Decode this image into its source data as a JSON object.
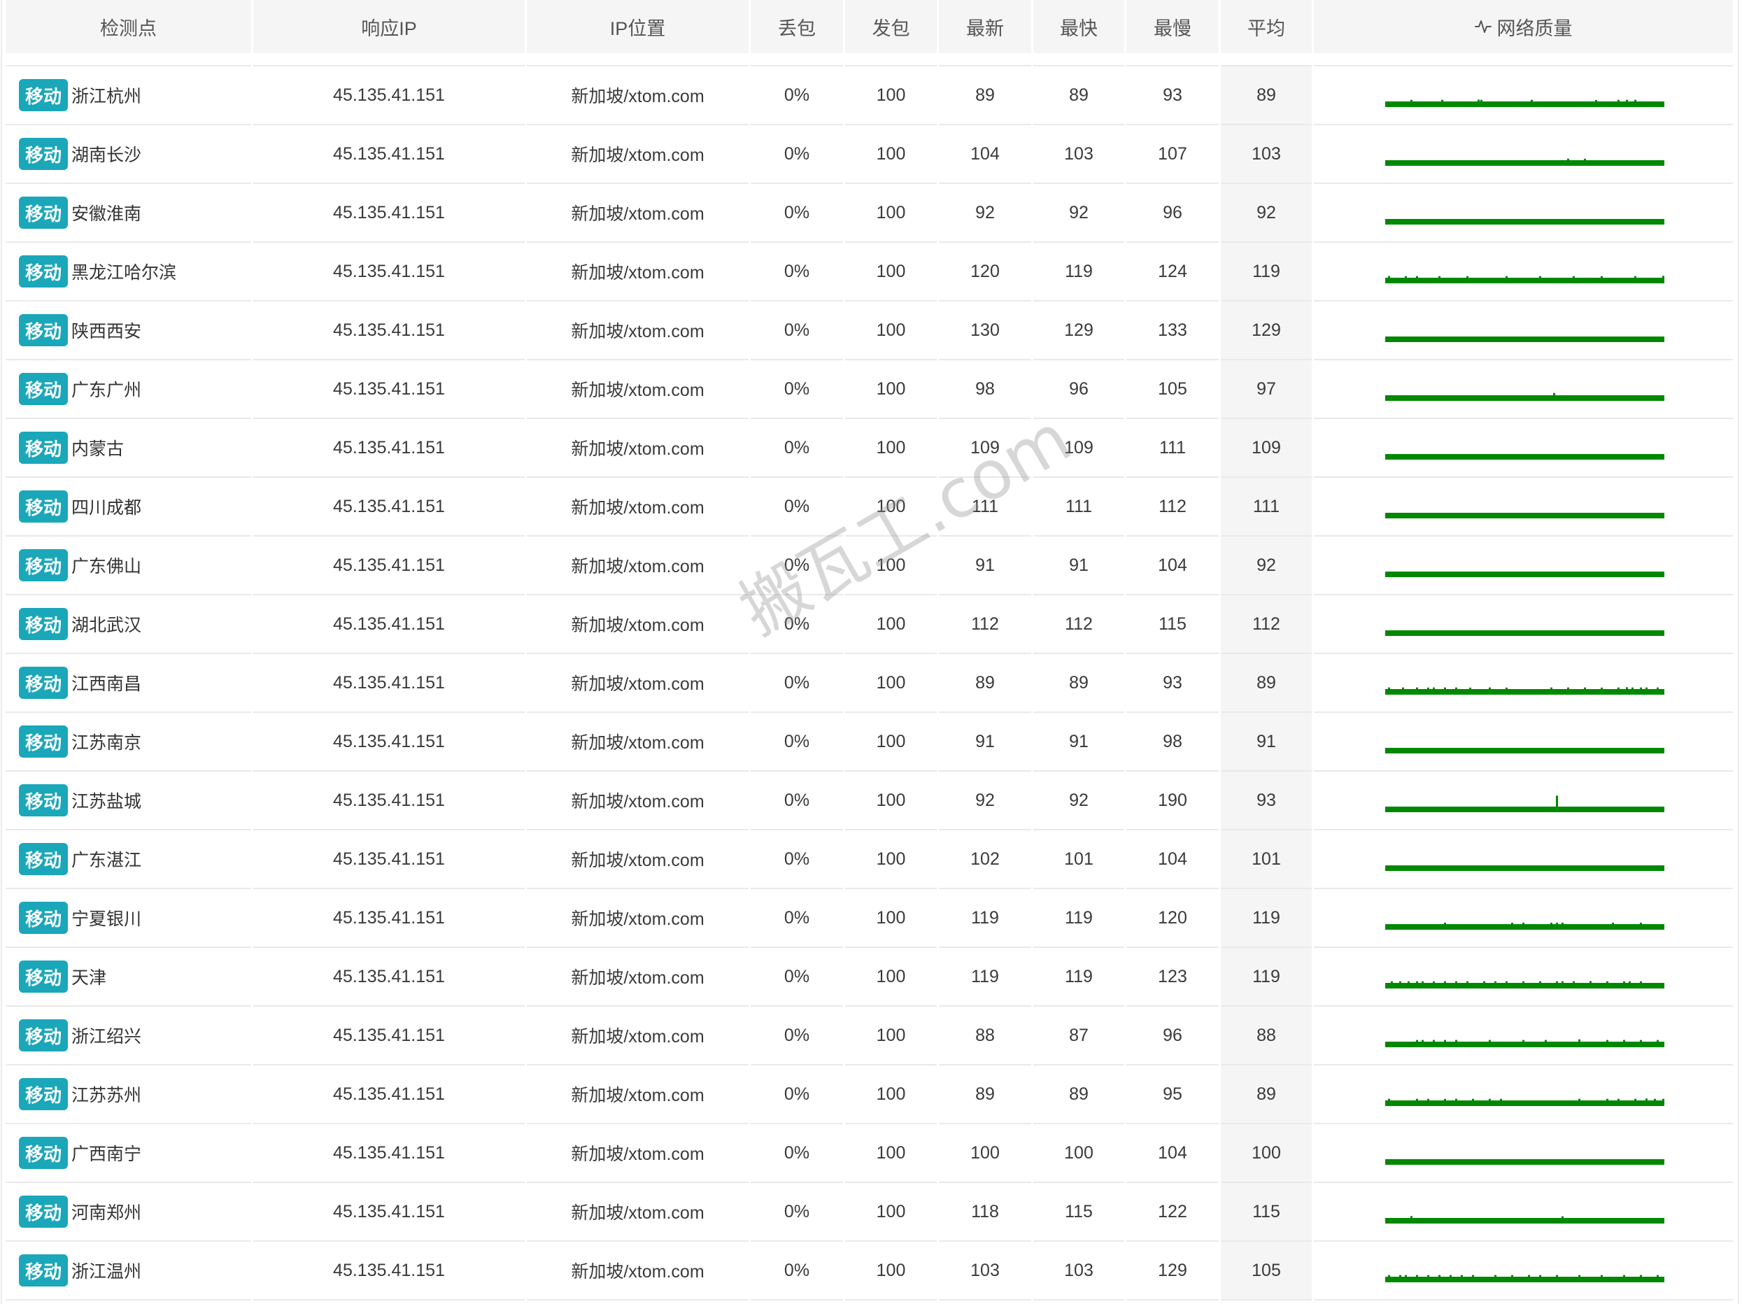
{
  "table": {
    "columns": [
      "检测点",
      "响应IP",
      "IP位置",
      "丢包",
      "发包",
      "最新",
      "最快",
      "最慢",
      "平均",
      "网络质量"
    ],
    "rows": [
      {
        "isp": "移动",
        "location": "浙江杭州",
        "ip": "45.135.41.151",
        "ip_location": "新加坡/xtom.com",
        "loss": "0%",
        "sent": "100",
        "latest": "89",
        "fastest": "89",
        "slowest": "93",
        "average": "89",
        "quality_spikes": [
          [
            9,
            91
          ],
          [
            20,
            91
          ],
          [
            33,
            93
          ],
          [
            34,
            92
          ],
          [
            52,
            91
          ],
          [
            75,
            90
          ],
          [
            83,
            91
          ],
          [
            86,
            91
          ],
          [
            89,
            92
          ]
        ]
      },
      {
        "isp": "移动",
        "location": "湖南长沙",
        "ip": "45.135.41.151",
        "ip_location": "新加坡/xtom.com",
        "loss": "0%",
        "sent": "100",
        "latest": "104",
        "fastest": "103",
        "slowest": "107",
        "average": "103",
        "quality_spikes": [
          [
            65,
            105
          ],
          [
            71,
            104
          ]
        ]
      },
      {
        "isp": "移动",
        "location": "安徽淮南",
        "ip": "45.135.41.151",
        "ip_location": "新加坡/xtom.com",
        "loss": "0%",
        "sent": "100",
        "latest": "92",
        "fastest": "92",
        "slowest": "96",
        "average": "92",
        "quality_spikes": []
      },
      {
        "isp": "移动",
        "location": "黑龙江哈尔滨",
        "ip": "45.135.41.151",
        "ip_location": "新加坡/xtom.com",
        "loss": "0%",
        "sent": "100",
        "latest": "120",
        "fastest": "119",
        "slowest": "124",
        "average": "119",
        "quality_spikes": [
          [
            1,
            122
          ],
          [
            7,
            121
          ],
          [
            11,
            121
          ],
          [
            19,
            121
          ],
          [
            29,
            121
          ],
          [
            43,
            121
          ],
          [
            55,
            121
          ],
          [
            67,
            121
          ],
          [
            77,
            121
          ],
          [
            89,
            121
          ],
          [
            99,
            124
          ]
        ]
      },
      {
        "isp": "移动",
        "location": "陕西西安",
        "ip": "45.135.41.151",
        "ip_location": "新加坡/xtom.com",
        "loss": "0%",
        "sent": "100",
        "latest": "130",
        "fastest": "129",
        "slowest": "133",
        "average": "129",
        "quality_spikes": []
      },
      {
        "isp": "移动",
        "location": "广东广州",
        "ip": "45.135.41.151",
        "ip_location": "新加坡/xtom.com",
        "loss": "0%",
        "sent": "100",
        "latest": "98",
        "fastest": "96",
        "slowest": "105",
        "average": "97",
        "quality_spikes": [
          [
            60,
            105
          ]
        ]
      },
      {
        "isp": "移动",
        "location": "内蒙古",
        "ip": "45.135.41.151",
        "ip_location": "新加坡/xtom.com",
        "loss": "0%",
        "sent": "100",
        "latest": "109",
        "fastest": "109",
        "slowest": "111",
        "average": "109",
        "quality_spikes": []
      },
      {
        "isp": "移动",
        "location": "四川成都",
        "ip": "45.135.41.151",
        "ip_location": "新加坡/xtom.com",
        "loss": "0%",
        "sent": "100",
        "latest": "111",
        "fastest": "111",
        "slowest": "112",
        "average": "111",
        "quality_spikes": []
      },
      {
        "isp": "移动",
        "location": "广东佛山",
        "ip": "45.135.41.151",
        "ip_location": "新加坡/xtom.com",
        "loss": "0%",
        "sent": "100",
        "latest": "91",
        "fastest": "91",
        "slowest": "104",
        "average": "92",
        "quality_spikes": []
      },
      {
        "isp": "移动",
        "location": "湖北武汉",
        "ip": "45.135.41.151",
        "ip_location": "新加坡/xtom.com",
        "loss": "0%",
        "sent": "100",
        "latest": "112",
        "fastest": "112",
        "slowest": "115",
        "average": "112",
        "quality_spikes": []
      },
      {
        "isp": "移动",
        "location": "江西南昌",
        "ip": "45.135.41.151",
        "ip_location": "新加坡/xtom.com",
        "loss": "0%",
        "sent": "100",
        "latest": "89",
        "fastest": "89",
        "slowest": "93",
        "average": "89",
        "quality_spikes": [
          [
            1,
            91
          ],
          [
            6,
            91
          ],
          [
            11,
            91
          ],
          [
            15,
            90
          ],
          [
            17,
            91
          ],
          [
            21,
            91
          ],
          [
            25,
            91
          ],
          [
            30,
            90
          ],
          [
            37,
            91
          ],
          [
            43,
            90
          ],
          [
            59,
            91
          ],
          [
            65,
            91
          ],
          [
            71,
            91
          ],
          [
            77,
            90
          ],
          [
            83,
            91
          ],
          [
            86,
            93
          ],
          [
            88,
            91
          ],
          [
            91,
            91
          ],
          [
            93,
            91
          ],
          [
            97,
            91
          ]
        ]
      },
      {
        "isp": "移动",
        "location": "江苏南京",
        "ip": "45.135.41.151",
        "ip_location": "新加坡/xtom.com",
        "loss": "0%",
        "sent": "100",
        "latest": "91",
        "fastest": "91",
        "slowest": "98",
        "average": "91",
        "quality_spikes": []
      },
      {
        "isp": "移动",
        "location": "江苏盐城",
        "ip": "45.135.41.151",
        "ip_location": "新加坡/xtom.com",
        "loss": "0%",
        "sent": "100",
        "latest": "92",
        "fastest": "92",
        "slowest": "190",
        "average": "93",
        "quality_spikes": [
          [
            61,
            190
          ]
        ]
      },
      {
        "isp": "移动",
        "location": "广东湛江",
        "ip": "45.135.41.151",
        "ip_location": "新加坡/xtom.com",
        "loss": "0%",
        "sent": "100",
        "latest": "102",
        "fastest": "101",
        "slowest": "104",
        "average": "101",
        "quality_spikes": []
      },
      {
        "isp": "移动",
        "location": "宁夏银川",
        "ip": "45.135.41.151",
        "ip_location": "新加坡/xtom.com",
        "loss": "0%",
        "sent": "100",
        "latest": "119",
        "fastest": "119",
        "slowest": "120",
        "average": "119",
        "quality_spikes": [
          [
            21,
            120
          ],
          [
            45,
            120
          ],
          [
            49,
            120
          ],
          [
            59,
            120
          ],
          [
            61,
            120
          ],
          [
            63,
            120
          ],
          [
            81,
            120
          ],
          [
            91,
            120
          ]
        ]
      },
      {
        "isp": "移动",
        "location": "天津",
        "ip": "45.135.41.151",
        "ip_location": "新加坡/xtom.com",
        "loss": "0%",
        "sent": "100",
        "latest": "119",
        "fastest": "119",
        "slowest": "123",
        "average": "119",
        "quality_spikes": [
          [
            2,
            121
          ],
          [
            5,
            121
          ],
          [
            8,
            121
          ],
          [
            11,
            121
          ],
          [
            13,
            121
          ],
          [
            17,
            121
          ],
          [
            21,
            121
          ],
          [
            25,
            121
          ],
          [
            29,
            121
          ],
          [
            35,
            121
          ],
          [
            39,
            121
          ],
          [
            43,
            121
          ],
          [
            49,
            121
          ],
          [
            55,
            121
          ],
          [
            61,
            121
          ],
          [
            63,
            121
          ],
          [
            67,
            121
          ],
          [
            73,
            123
          ],
          [
            79,
            121
          ],
          [
            85,
            121
          ],
          [
            87,
            121
          ],
          [
            91,
            121
          ]
        ]
      },
      {
        "isp": "移动",
        "location": "浙江绍兴",
        "ip": "45.135.41.151",
        "ip_location": "新加坡/xtom.com",
        "loss": "0%",
        "sent": "100",
        "latest": "88",
        "fastest": "87",
        "slowest": "96",
        "average": "88",
        "quality_spikes": [
          [
            11,
            90
          ],
          [
            13,
            90
          ],
          [
            17,
            90
          ],
          [
            21,
            90
          ],
          [
            25,
            90
          ],
          [
            37,
            90
          ],
          [
            49,
            90
          ],
          [
            57,
            90
          ],
          [
            69,
            96
          ],
          [
            79,
            90
          ],
          [
            85,
            90
          ],
          [
            91,
            90
          ],
          [
            97,
            90
          ]
        ]
      },
      {
        "isp": "移动",
        "location": "江苏苏州",
        "ip": "45.135.41.151",
        "ip_location": "新加坡/xtom.com",
        "loss": "0%",
        "sent": "100",
        "latest": "89",
        "fastest": "89",
        "slowest": "95",
        "average": "89",
        "quality_spikes": [
          [
            1,
            91
          ],
          [
            11,
            91
          ],
          [
            15,
            91
          ],
          [
            21,
            91
          ],
          [
            25,
            91
          ],
          [
            31,
            91
          ],
          [
            37,
            91
          ],
          [
            41,
            91
          ],
          [
            69,
            91
          ],
          [
            79,
            91
          ],
          [
            83,
            91
          ],
          [
            89,
            91
          ],
          [
            93,
            95
          ],
          [
            96,
            91
          ],
          [
            99,
            91
          ]
        ]
      },
      {
        "isp": "移动",
        "location": "广西南宁",
        "ip": "45.135.41.151",
        "ip_location": "新加坡/xtom.com",
        "loss": "0%",
        "sent": "100",
        "latest": "100",
        "fastest": "100",
        "slowest": "104",
        "average": "100",
        "quality_spikes": []
      },
      {
        "isp": "移动",
        "location": "河南郑州",
        "ip": "45.135.41.151",
        "ip_location": "新加坡/xtom.com",
        "loss": "0%",
        "sent": "100",
        "latest": "118",
        "fastest": "115",
        "slowest": "122",
        "average": "115",
        "quality_spikes": [
          [
            9,
            120
          ],
          [
            63,
            117
          ]
        ]
      },
      {
        "isp": "移动",
        "location": "浙江温州",
        "ip": "45.135.41.151",
        "ip_location": "新加坡/xtom.com",
        "loss": "0%",
        "sent": "100",
        "latest": "103",
        "fastest": "103",
        "slowest": "129",
        "average": "105",
        "quality_spikes": [
          [
            1,
            106
          ],
          [
            5,
            106
          ],
          [
            7,
            106
          ],
          [
            11,
            106
          ],
          [
            15,
            106
          ],
          [
            19,
            106
          ],
          [
            23,
            106
          ],
          [
            27,
            106
          ],
          [
            31,
            106
          ],
          [
            39,
            106
          ],
          [
            45,
            106
          ],
          [
            51,
            106
          ],
          [
            55,
            106
          ],
          [
            61,
            106
          ],
          [
            69,
            106
          ],
          [
            77,
            106
          ],
          [
            85,
            106
          ],
          [
            91,
            106
          ],
          [
            97,
            106
          ]
        ]
      }
    ]
  },
  "icons": {
    "network_quality_header": "activity-icon"
  },
  "colors": {
    "isp_badge": "#1aa7b9",
    "quality_line": "#008800",
    "header_bg": "#f5f5f5",
    "average_column_bg": "#f5f5f5"
  },
  "watermark": "搬瓦工.com"
}
